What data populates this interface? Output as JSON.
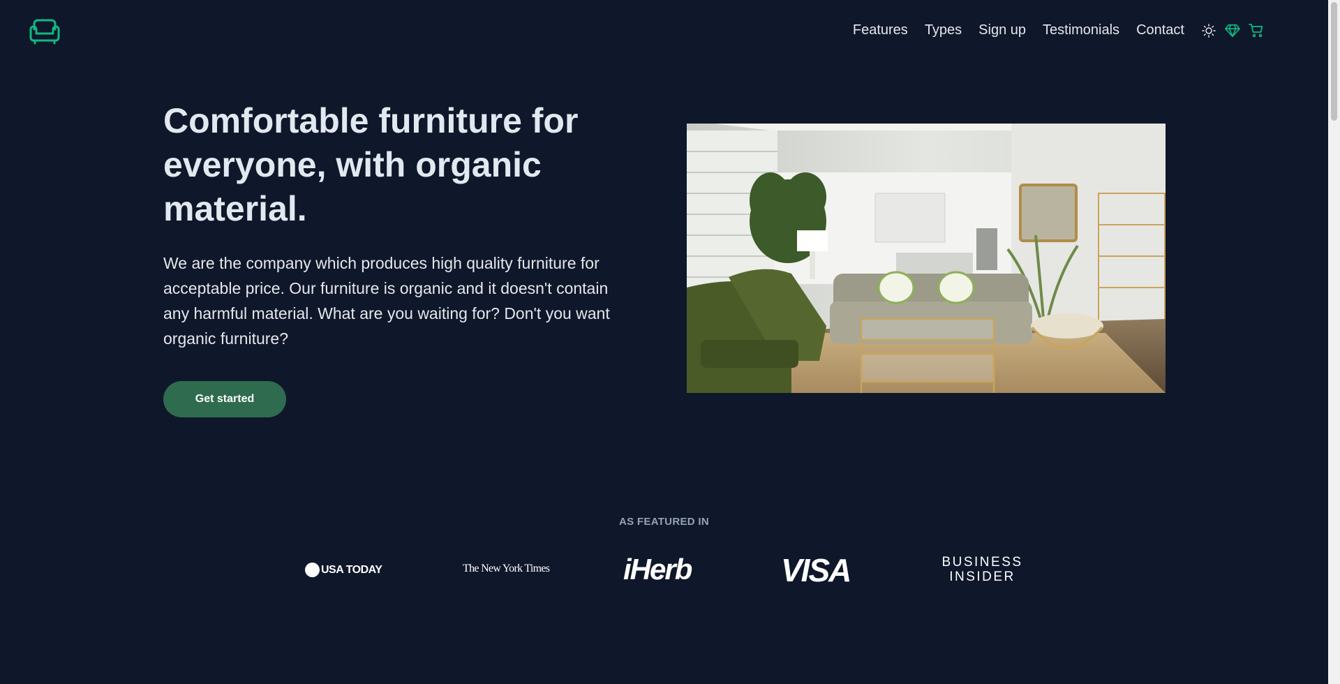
{
  "nav": {
    "items": [
      "Features",
      "Types",
      "Sign up",
      "Testimonials",
      "Contact"
    ],
    "icons": [
      "sun-icon",
      "diamond-icon",
      "cart-icon"
    ]
  },
  "hero": {
    "title": "Comfortable furniture for everyone, with organic material.",
    "text": "We are the company which produces high quality furniture for acceptable price. Our furniture is organic and it doesn't contain any harmful material. What are you waiting for? Don't you want organic furniture?",
    "cta": "Get started"
  },
  "featured": {
    "title": "AS FEATURED IN",
    "brands": [
      "USA TODAY",
      "The New York Times",
      "iHerb",
      "VISA",
      "BUSINESS",
      "INSIDER"
    ]
  },
  "colors": {
    "background": "#0f172a",
    "accent": "#10b981",
    "button": "#2f6b4f"
  }
}
